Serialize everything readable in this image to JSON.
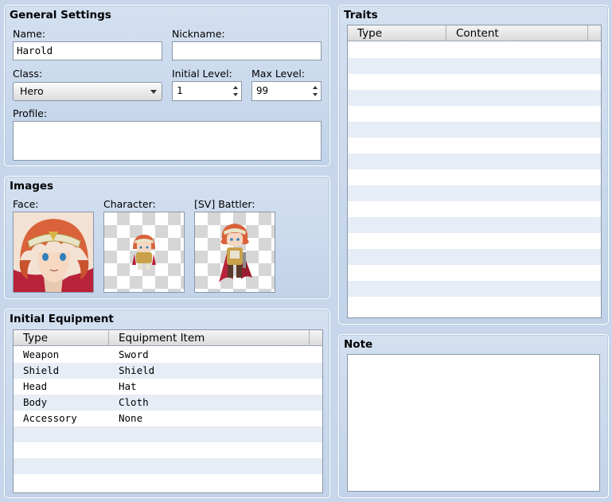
{
  "general": {
    "title": "General Settings",
    "name_label": "Name:",
    "name_value": "Harold",
    "nickname_label": "Nickname:",
    "nickname_value": "",
    "class_label": "Class:",
    "class_value": "Hero",
    "initial_level_label": "Initial Level:",
    "initial_level_value": "1",
    "max_level_label": "Max Level:",
    "max_level_value": "99",
    "profile_label": "Profile:",
    "profile_value": ""
  },
  "images": {
    "title": "Images",
    "face_label": "Face:",
    "character_label": "Character:",
    "battler_label": "[SV] Battler:"
  },
  "equipment": {
    "title": "Initial Equipment",
    "columns": [
      "Type",
      "Equipment Item"
    ],
    "rows": [
      {
        "type": "Weapon",
        "item": "Sword"
      },
      {
        "type": "Shield",
        "item": "Shield"
      },
      {
        "type": "Head",
        "item": "Hat"
      },
      {
        "type": "Body",
        "item": "Cloth"
      },
      {
        "type": "Accessory",
        "item": "None"
      }
    ]
  },
  "traits": {
    "title": "Traits",
    "columns": [
      "Type",
      "Content"
    ]
  },
  "note": {
    "title": "Note",
    "value": ""
  },
  "colors": {
    "panel_bg": "#c7d6ea",
    "row_alt": "#e6edf6",
    "hair": "#d9623a",
    "cape": "#b8233a"
  }
}
